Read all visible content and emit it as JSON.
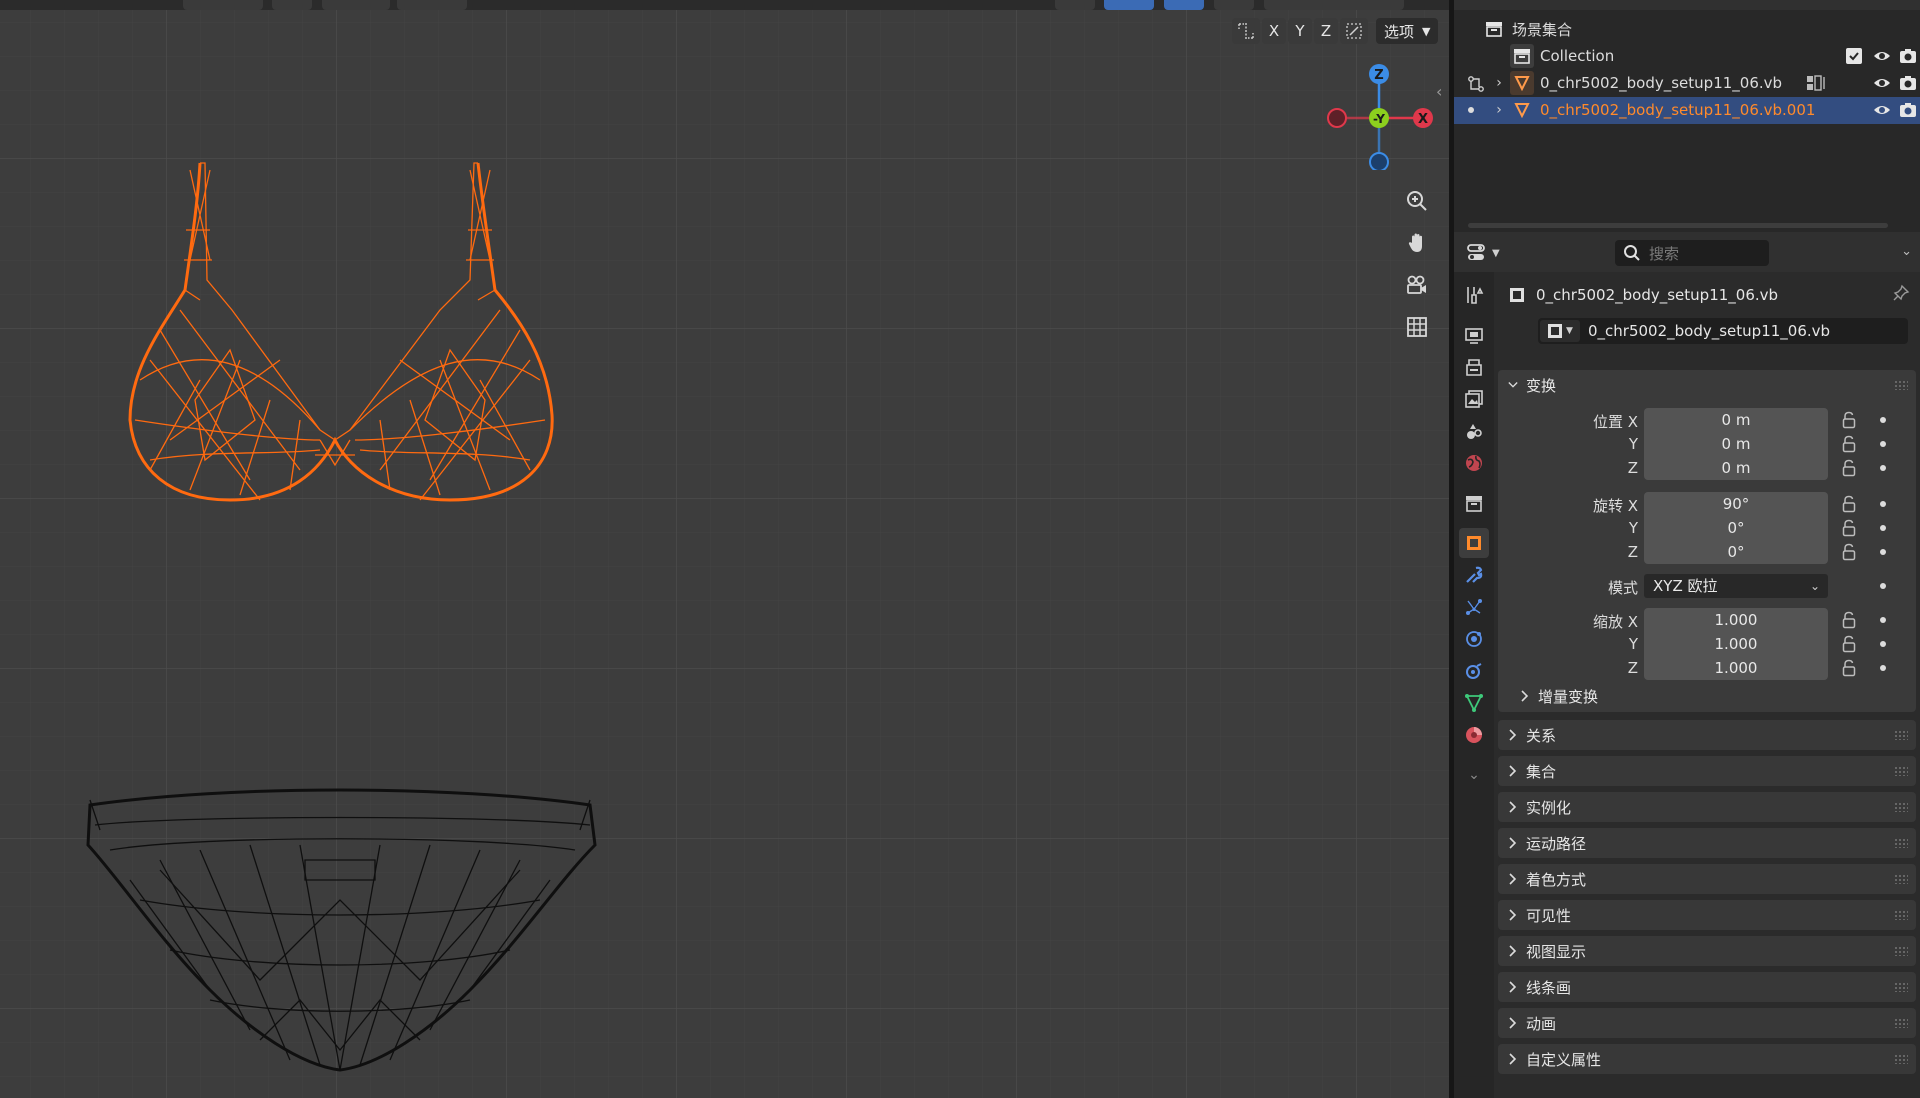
{
  "viewport": {
    "axis_x": "X",
    "axis_y": "Y",
    "axis_z": "Z",
    "options_label": "选项",
    "gizmo": {
      "z": "Z",
      "y": "-Y",
      "x": "X"
    }
  },
  "outliner": {
    "scene_collection": "场景集合",
    "collection": "Collection",
    "objects": [
      {
        "name": "0_chr5002_body_setup11_06.vb"
      },
      {
        "name": "0_chr5002_body_setup11_06.vb.001"
      }
    ]
  },
  "properties": {
    "search_placeholder": "搜索",
    "object_title": "0_chr5002_body_setup11_06.vb",
    "object_name_field": "0_chr5002_body_setup11_06.vb",
    "transform": {
      "header": "变换",
      "location_label": "位置 X",
      "location": [
        "0 m",
        "0 m",
        "0 m"
      ],
      "rotation_label": "旋转 X",
      "rotation": [
        "90°",
        "0°",
        "0°"
      ],
      "mode_label": "模式",
      "mode_value": "XYZ 欧拉",
      "scale_label": "缩放 X",
      "scale": [
        "1.000",
        "1.000",
        "1.000"
      ],
      "axis_y": "Y",
      "axis_z": "Z",
      "delta_transform": "增量变换"
    },
    "panels": [
      "关系",
      "集合",
      "实例化",
      "运动路径",
      "着色方式",
      "可见性",
      "视图显示",
      "线条画",
      "动画",
      "自定义属性"
    ]
  },
  "colors": {
    "viewport_bg": "#3d3d3d",
    "selected_mesh": "#ff6a10",
    "wire_mesh": "#111111",
    "selection_highlight": "#334d80",
    "axis_x": "#e0384b",
    "axis_y": "#8ccf1e",
    "axis_z": "#3b8ce6"
  }
}
